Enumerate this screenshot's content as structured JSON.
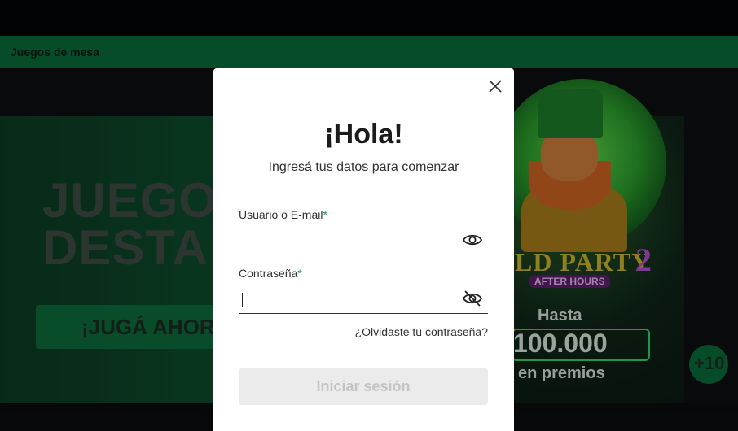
{
  "nav": {
    "item_label": "Juegos de mesa"
  },
  "hero": {
    "title_line1": "JUEGO",
    "title_line2": "DESTA",
    "cta_label": "¡JUGÁ AHOR"
  },
  "promo": {
    "logo": "LD PARTY",
    "logo_number": "2",
    "subtitle": "AFTER HOURS",
    "hasta": "Hasta",
    "amount": "100.000",
    "premios": "en premios",
    "fab_label": "+10"
  },
  "modal": {
    "title": "¡Hola!",
    "subtitle": "Ingresá tus datos para comenzar",
    "username": {
      "label": "Usuario o E-mail",
      "required_mark": "*",
      "value": "",
      "placeholder": ""
    },
    "password": {
      "label": "Contraseña",
      "required_mark": "*",
      "value": "",
      "placeholder": ""
    },
    "forgot_link": "¿Olvidaste tu contraseña?",
    "submit_label": "Iniciar sesión",
    "icons": {
      "close": "close-icon",
      "show_password": "eye-icon",
      "hide_password": "eye-off-icon"
    }
  },
  "colors": {
    "accent": "#12a04a",
    "nav_green": "#0a6a3a",
    "modal_bg": "#ffffff",
    "button_disabled": "#ebebeb"
  }
}
